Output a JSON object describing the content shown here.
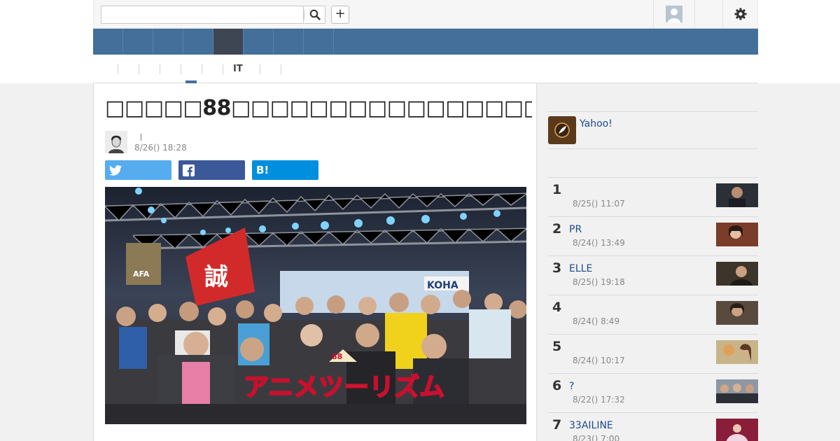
{
  "search": {
    "placeholder": "",
    "value": ""
  },
  "icons": {
    "search": "search-icon",
    "plus": "plus-icon",
    "avatar": "user-avatar-icon",
    "gear": "gear-icon",
    "twitter": "twitter-icon",
    "facebook": "facebook-icon",
    "hatena": "hatena-bookmark-icon",
    "yahoo": "yahoo-feather-icon"
  },
  "header": {
    "plus_label": "+"
  },
  "subnav": {
    "it_label": "IT"
  },
  "article": {
    "title": "□□□□□88□□□□□□□□□□□□□□□□□□□□□□□□□□□□□□□",
    "date": "8/26() 18:28",
    "hatena_label": "B!",
    "photo_logo_number": "88",
    "photo_logo_text": "アニメツーリズム"
  },
  "sidebar": {
    "yahoo_label": "Yahoo!",
    "ranking": [
      {
        "rank": "1",
        "title": "",
        "date": "8/25() 11:07"
      },
      {
        "rank": "2",
        "title": "PR",
        "date": "8/24() 13:49"
      },
      {
        "rank": "3",
        "title": "ELLE",
        "date": "8/25() 19:18"
      },
      {
        "rank": "4",
        "title": "",
        "date": "8/24() 8:49"
      },
      {
        "rank": "5",
        "title": "",
        "date": "8/24() 10:17"
      },
      {
        "rank": "6",
        "title": "?",
        "date": "8/22() 17:32"
      },
      {
        "rank": "7",
        "title": "33AILINE",
        "date": "8/23() 7:00"
      }
    ]
  },
  "colors": {
    "nav_blue": "#436f9a",
    "nav_active": "#3e4553",
    "twitter": "#55acee",
    "facebook": "#3b5998",
    "hatena": "#008fde",
    "link": "#1a4b8c"
  }
}
